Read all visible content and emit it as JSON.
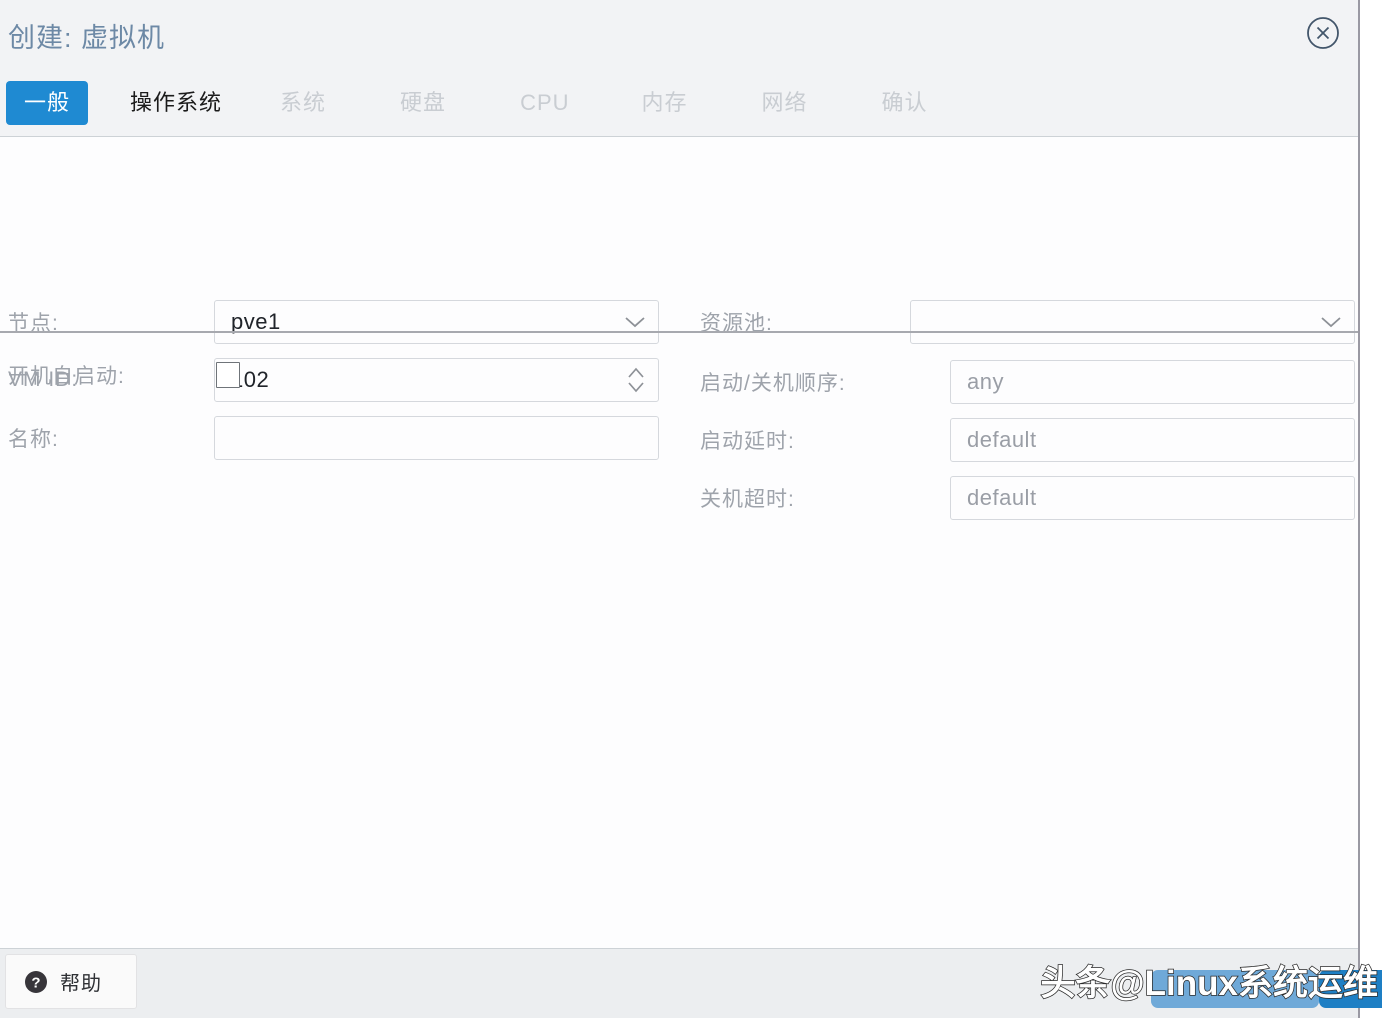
{
  "window": {
    "title": "创建: 虚拟机",
    "close_icon": "close-circle-icon",
    "accent_color": "#1f8ad2",
    "title_color": "#6d89a6"
  },
  "tabs": [
    {
      "label": "一般",
      "state": "active"
    },
    {
      "label": "操作系统",
      "state": "enabled"
    },
    {
      "label": "系统",
      "state": "disabled"
    },
    {
      "label": "硬盘",
      "state": "disabled"
    },
    {
      "label": "CPU",
      "state": "disabled"
    },
    {
      "label": "内存",
      "state": "disabled"
    },
    {
      "label": "网络",
      "state": "disabled"
    },
    {
      "label": "确认",
      "state": "disabled"
    }
  ],
  "form": {
    "left": {
      "node": {
        "label": "节点:",
        "value": "pve1",
        "control": "dropdown",
        "icon": "chevron-down-icon"
      },
      "vmid": {
        "label": "VM ID:",
        "value": "102",
        "control": "spinner",
        "icon": "spinner-arrows-icon"
      },
      "name": {
        "label": "名称:",
        "value": "",
        "placeholder": "",
        "control": "text"
      },
      "start_at_boot": {
        "label": "开机自启动:",
        "checked": false,
        "control": "checkbox"
      }
    },
    "right": {
      "pool": {
        "label": "资源池:",
        "value": "",
        "control": "dropdown",
        "icon": "chevron-down-icon"
      },
      "start_order": {
        "label": "启动/关机顺序:",
        "value": "any",
        "is_placeholder": true,
        "control": "text"
      },
      "startup_delay": {
        "label": "启动延时:",
        "value": "default",
        "is_placeholder": true,
        "control": "text"
      },
      "shutdown_timeout": {
        "label": "关机超时:",
        "value": "default",
        "is_placeholder": true,
        "control": "text"
      }
    }
  },
  "footer": {
    "help": {
      "label": "帮助",
      "icon": "question-circle-icon"
    }
  },
  "watermark": {
    "prefix": "头条 ",
    "handle": "@Linux",
    "suffix": "系统运维",
    "light_color": "#6fa9d8",
    "dark_color": "#1e7fc4"
  }
}
